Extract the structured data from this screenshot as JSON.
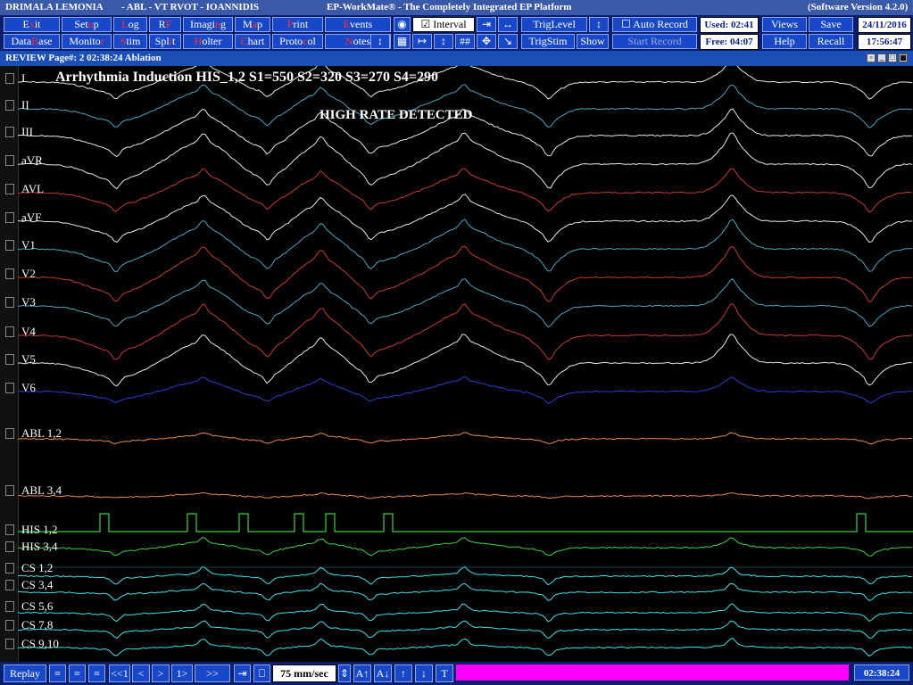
{
  "titlebar": {
    "patient": "DRIMALA LEMONIA",
    "study": "-   ABL - VT RVOT - IOANNIDIS",
    "app": "EP-WorkMate®  -  The Completely Integrated EP Platform",
    "version": "(Software Version 4.2.0)"
  },
  "toolbar": {
    "row1": [
      {
        "pre": "E",
        "hot": "x",
        "post": "it"
      },
      {
        "pre": "Set",
        "hot": "u",
        "post": "p"
      },
      {
        "pre": "",
        "hot": "L",
        "post": "og"
      },
      {
        "pre": "R",
        "hot": "F",
        "post": ""
      },
      {
        "pre": "Imagi",
        "hot": "n",
        "post": "g"
      },
      {
        "pre": "M",
        "hot": "a",
        "post": "p"
      },
      {
        "pre": "",
        "hot": "P",
        "post": "rint"
      },
      {
        "pre": "",
        "hot": "E",
        "post": "vents"
      }
    ],
    "row2": [
      {
        "pre": "Data",
        "hot": "B",
        "post": "ase"
      },
      {
        "pre": "Monito",
        "hot": "r",
        "post": ""
      },
      {
        "pre": "",
        "hot": "S",
        "post": "tim"
      },
      {
        "pre": "Spl",
        "hot": "i",
        "post": "t"
      },
      {
        "pre": "",
        "hot": "H",
        "post": "olter"
      },
      {
        "pre": "",
        "hot": "C",
        "post": "hart"
      },
      {
        "pre": "Proto",
        "hot": "c",
        "post": "ol"
      },
      {
        "pre": "",
        "hot": "N",
        "post": "otes"
      }
    ],
    "interval_label": "Interval",
    "triglevel_label": "TrigLevel",
    "trigstim_label": "TrigStim",
    "show_label": "Show",
    "auto_record_label": "Auto Record",
    "start_record_label": "Start Record",
    "used": "Used: 02:41",
    "free": "Free: 04:07",
    "views_label": "Views",
    "save_label": "Save",
    "help_label": "Help",
    "recall_label": "Recall",
    "date": "24/11/2016",
    "time": "17:56:47"
  },
  "review": {
    "title": "REVIEW Page#: 2    02:38:24   Ablation"
  },
  "overlay": {
    "header": "Arrhythmia Induction HIS_1,2 S1=550 S2=320 S3=270 S4=290",
    "alert": "HIGH RATE DETECTED"
  },
  "channels": [
    "I",
    "II",
    "III",
    "aVR",
    "AVL",
    "aVF",
    "V1",
    "V2",
    "V3",
    "V4",
    "V5",
    "V6",
    "ABL 1,2",
    "ABL 3,4",
    "HIS 1,2",
    "HIS 3,4",
    "CS 1,2",
    "CS 3,4",
    "CS 5,6",
    "CS 7,8",
    "CS 9,10"
  ],
  "bottombar": {
    "replay_label": "Replay",
    "nav_buttons": [
      "<<1",
      "<",
      "1>",
      ">>"
    ],
    "speed": "75",
    "speed_unit": "mm/sec",
    "time": "02:38:24"
  },
  "colors": {
    "title_bg": "#3a59a8",
    "toolbar_bg": "#0a1f6e",
    "button_bg": "#1848c8",
    "hotkey": "#ff3030",
    "progress": "#ff00ff",
    "trace_white": "#e8e8e8",
    "trace_red": "#c83a2a",
    "trace_cyan": "#4aa6c0",
    "trace_blue": "#2040d8",
    "trace_orange": "#e88850",
    "trace_green": "#40d040",
    "trace_cs": "#40e0e8"
  }
}
